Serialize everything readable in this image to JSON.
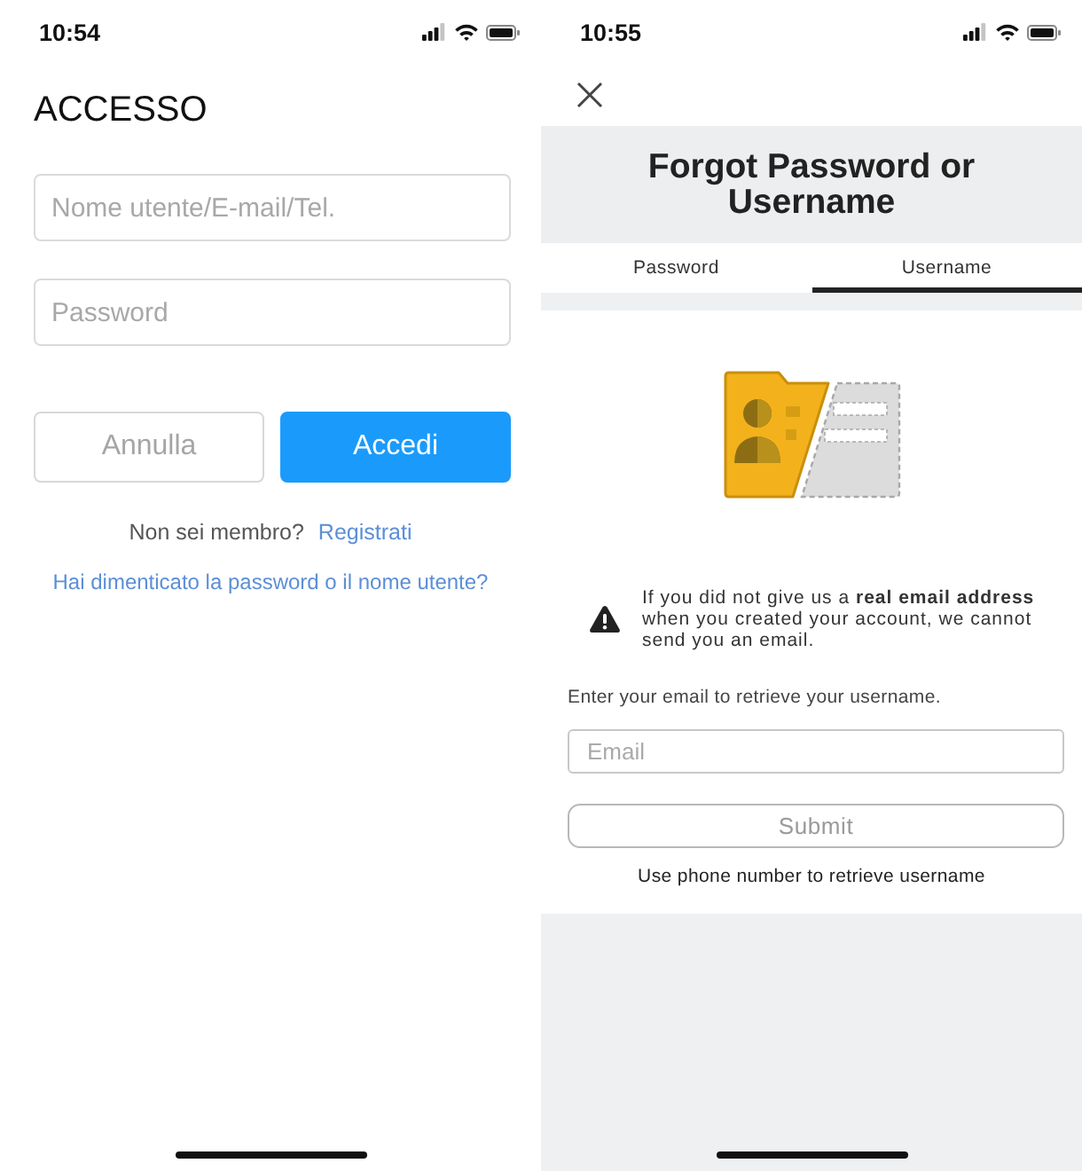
{
  "login_screen": {
    "status_bar": {
      "time": "10:54"
    },
    "title": "ACCESSO",
    "fields": [
      {
        "placeholder": "Nome utente/E-mail/Tel."
      },
      {
        "placeholder": "Password"
      }
    ],
    "buttons": [
      {
        "label": "Annulla",
        "kind": "secondary"
      },
      {
        "label": "Accedi",
        "kind": "primary"
      }
    ],
    "signup_prompt": {
      "text": "Non sei membro?",
      "link": "Registrati"
    },
    "forgot_link": "Hai dimenticato la password o il nome utente?"
  },
  "recovery_screen": {
    "status_bar": {
      "time": "10:55"
    },
    "title": "Forgot Password or Username",
    "tabs": [
      {
        "label": "Password",
        "selected": false
      },
      {
        "label": "Username",
        "selected": true
      }
    ],
    "notice": "If you did not give us a **real email address** when you created your account, we cannot send you an email.",
    "instruction": "Enter your email to retrieve your username.",
    "email_field": {
      "placeholder": "Email"
    },
    "submit_button": {
      "label": "Submit",
      "disabled": true
    },
    "phone_link": "Use phone number to retrieve username"
  }
}
